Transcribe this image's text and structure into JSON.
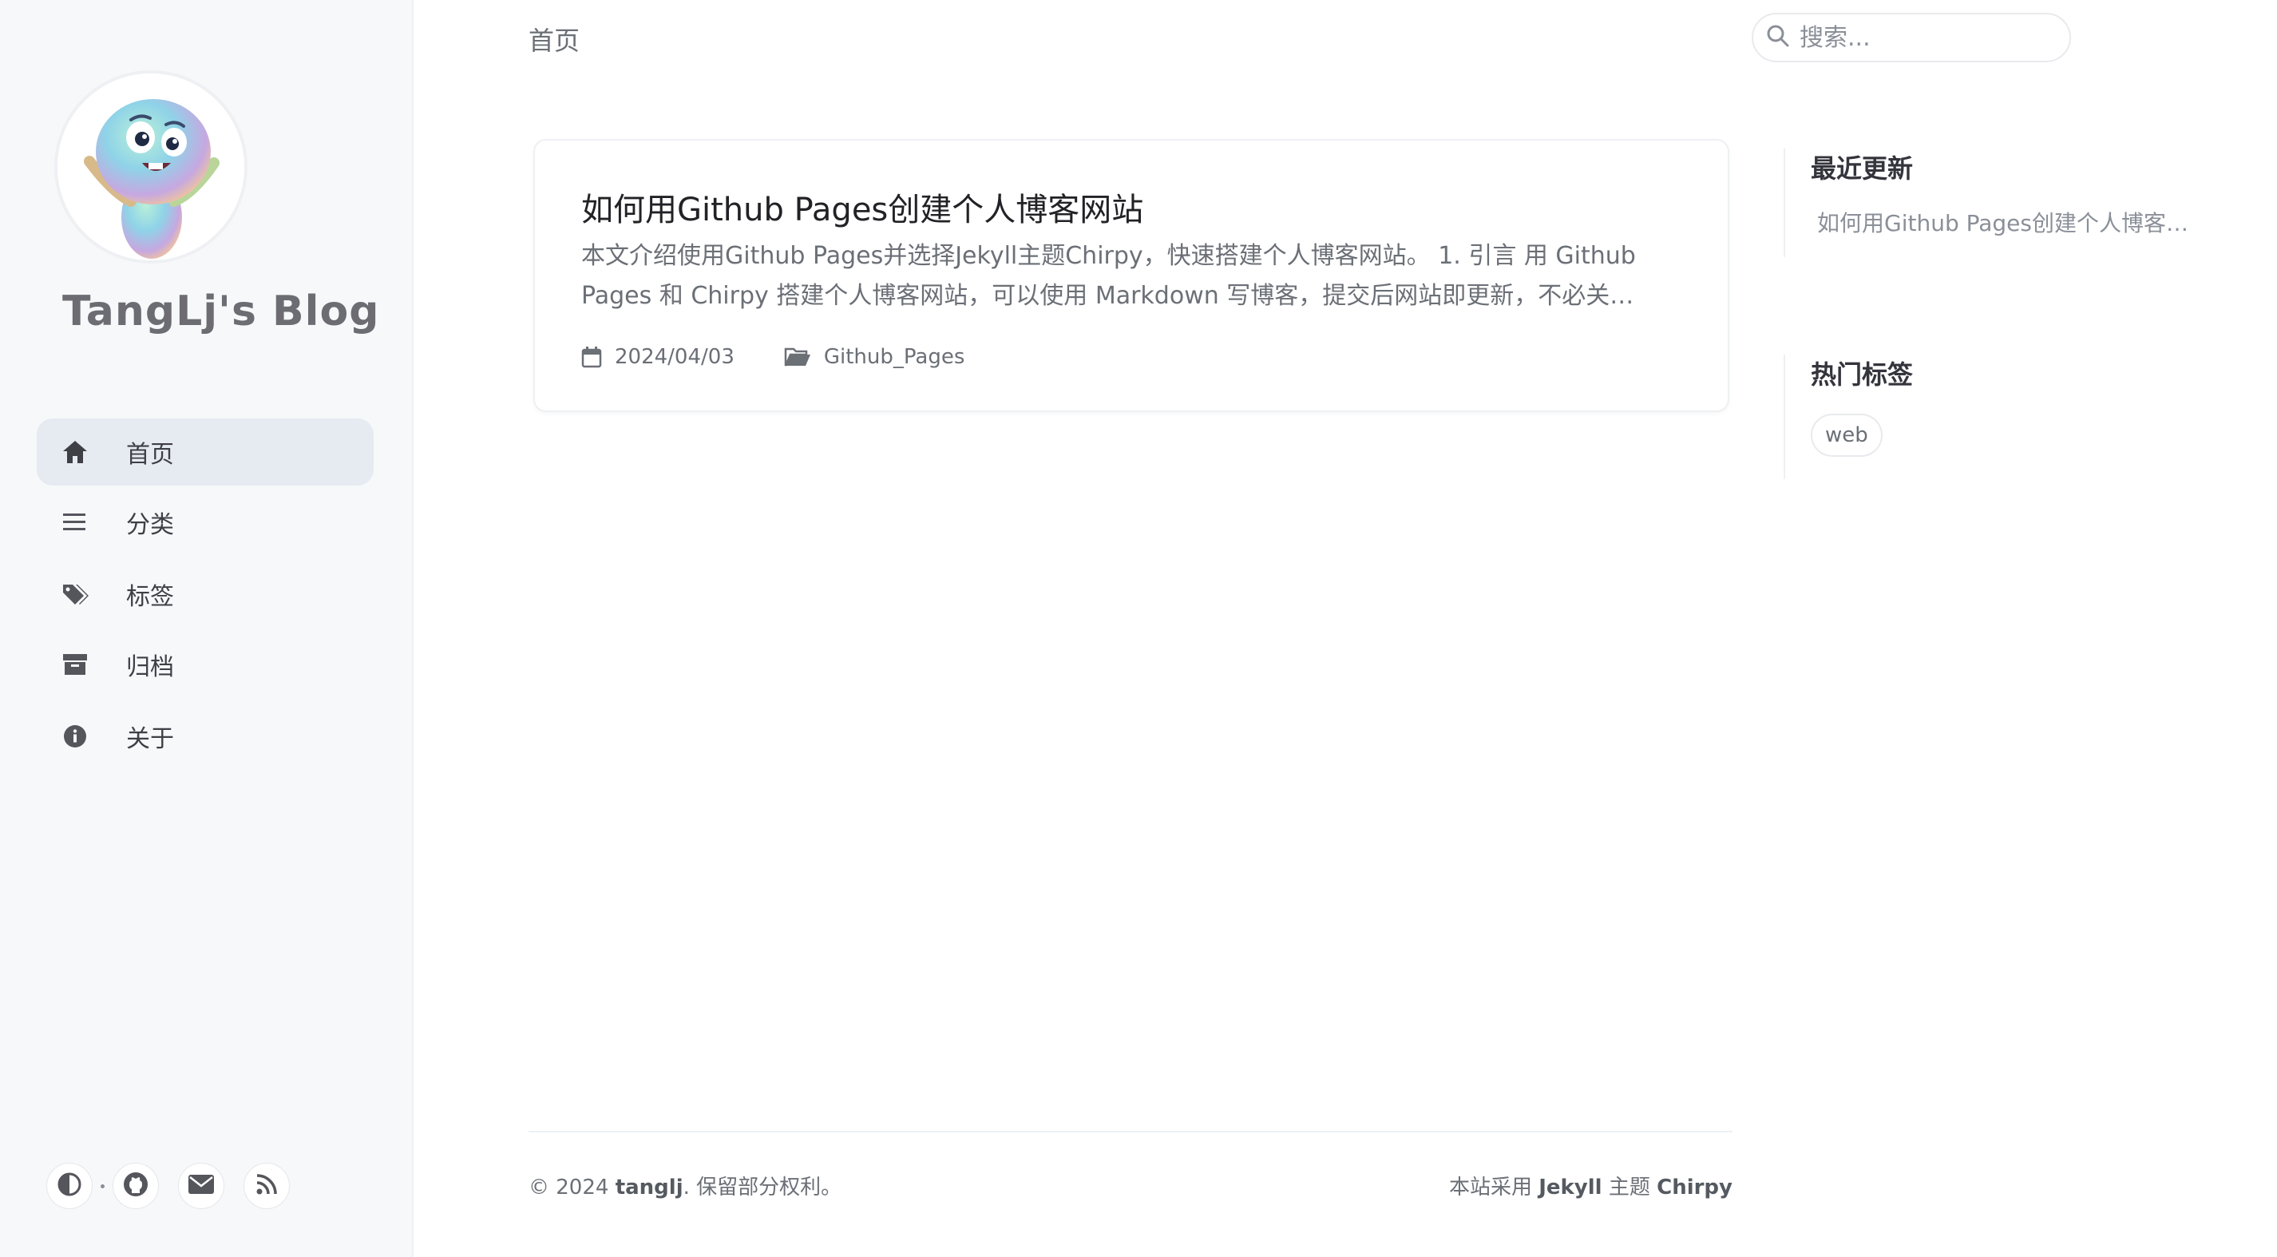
{
  "sidebar": {
    "site_title": "TangLj's Blog",
    "nav": [
      {
        "label": "首页",
        "icon": "home-icon",
        "active": true
      },
      {
        "label": "分类",
        "icon": "list-icon",
        "active": false
      },
      {
        "label": "标签",
        "icon": "tags-icon",
        "active": false
      },
      {
        "label": "归档",
        "icon": "archive-icon",
        "active": false
      },
      {
        "label": "关于",
        "icon": "info-circle-icon",
        "active": false
      }
    ],
    "bottom_icons": [
      "theme-toggle-icon",
      "github-icon",
      "email-icon",
      "rss-icon"
    ]
  },
  "topbar": {
    "breadcrumb": "首页",
    "search_placeholder": "搜索..."
  },
  "post": {
    "title": "如何用Github Pages创建个人博客网站",
    "excerpt": "本文介绍使用Github Pages并选择Jekyll主题Chirpy，快速搭建个人博客网站。 1. 引言 用 Github Pages 和 Chirpy 搭建个人博客网站，可以使用 Markdown 写博客，提交后网站即更新，不必关…",
    "date": "2024/04/03",
    "category": "Github_Pages"
  },
  "panels": {
    "recent_title": "最近更新",
    "recent_items": [
      "如何用Github Pages创建个人博客…"
    ],
    "tags_title": "热门标签",
    "tags": [
      "web"
    ]
  },
  "footer": {
    "copyright_prefix": "© 2024 ",
    "author": "tanglj",
    "rights": ". 保留部分权利。",
    "powered_prefix": "本站采用 ",
    "engine": "Jekyll",
    "theme_word": " 主题 ",
    "theme": "Chirpy"
  },
  "colors": {
    "sidebar_bg": "#f6f8fa",
    "active_nav_bg": "#e6ebf1",
    "text_muted": "#6b6f76"
  }
}
